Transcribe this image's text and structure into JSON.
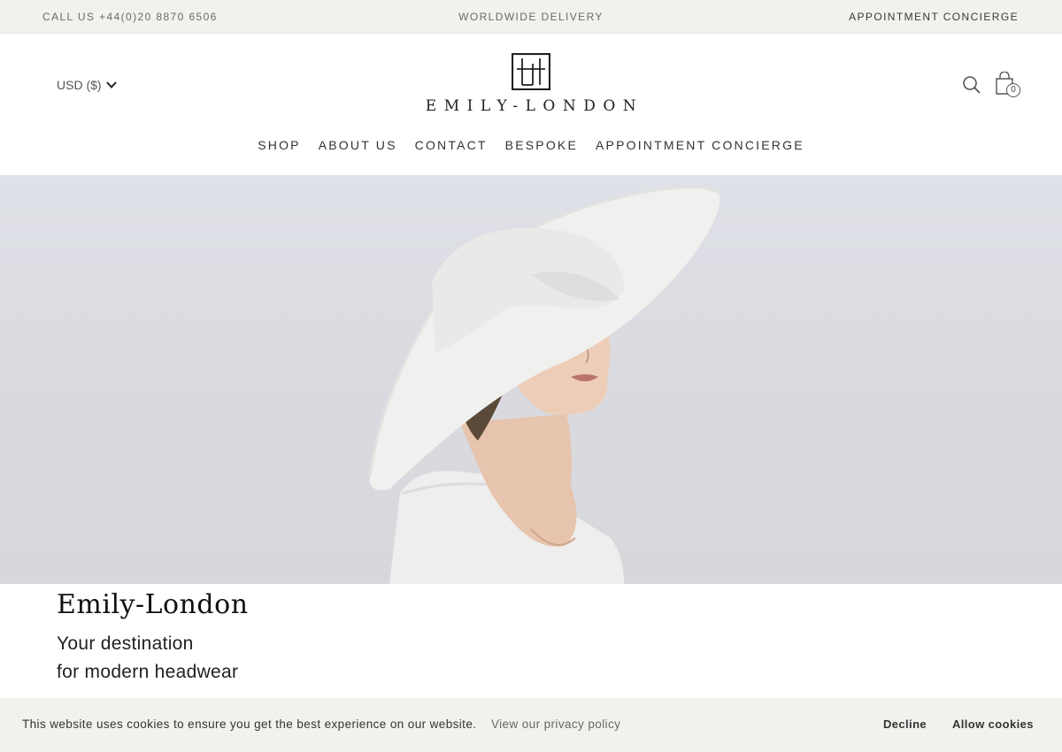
{
  "topbar": {
    "phone": "CALL US +44(0)20 8870 6506",
    "delivery": "WORLDWIDE DELIVERY",
    "appointment": "APPOINTMENT CONCIERGE"
  },
  "header": {
    "currency": "USD ($)",
    "logo_text": "EMILY-LONDON",
    "cart_count": "0",
    "icons": [
      "chevron-down-icon",
      "search-icon",
      "shopping-bag-icon"
    ]
  },
  "nav": {
    "items": [
      {
        "label": "SHOP"
      },
      {
        "label": "ABOUT US"
      },
      {
        "label": "CONTACT"
      },
      {
        "label": "BESPOKE"
      },
      {
        "label": "APPOINTMENT CONCIERGE"
      }
    ]
  },
  "intro": {
    "title": "Emily-London",
    "subtitle_line1": "Your destination",
    "subtitle_line2": "for modern headwear"
  },
  "cookie": {
    "message": "This website uses cookies to ensure you get the best experience on our website.",
    "link": "View our privacy policy",
    "decline": "Decline",
    "allow": "Allow cookies"
  },
  "colors": {
    "topbar_bg": "#f2f1ee",
    "hero_bg": "#dcdde3",
    "text": "#222222"
  }
}
